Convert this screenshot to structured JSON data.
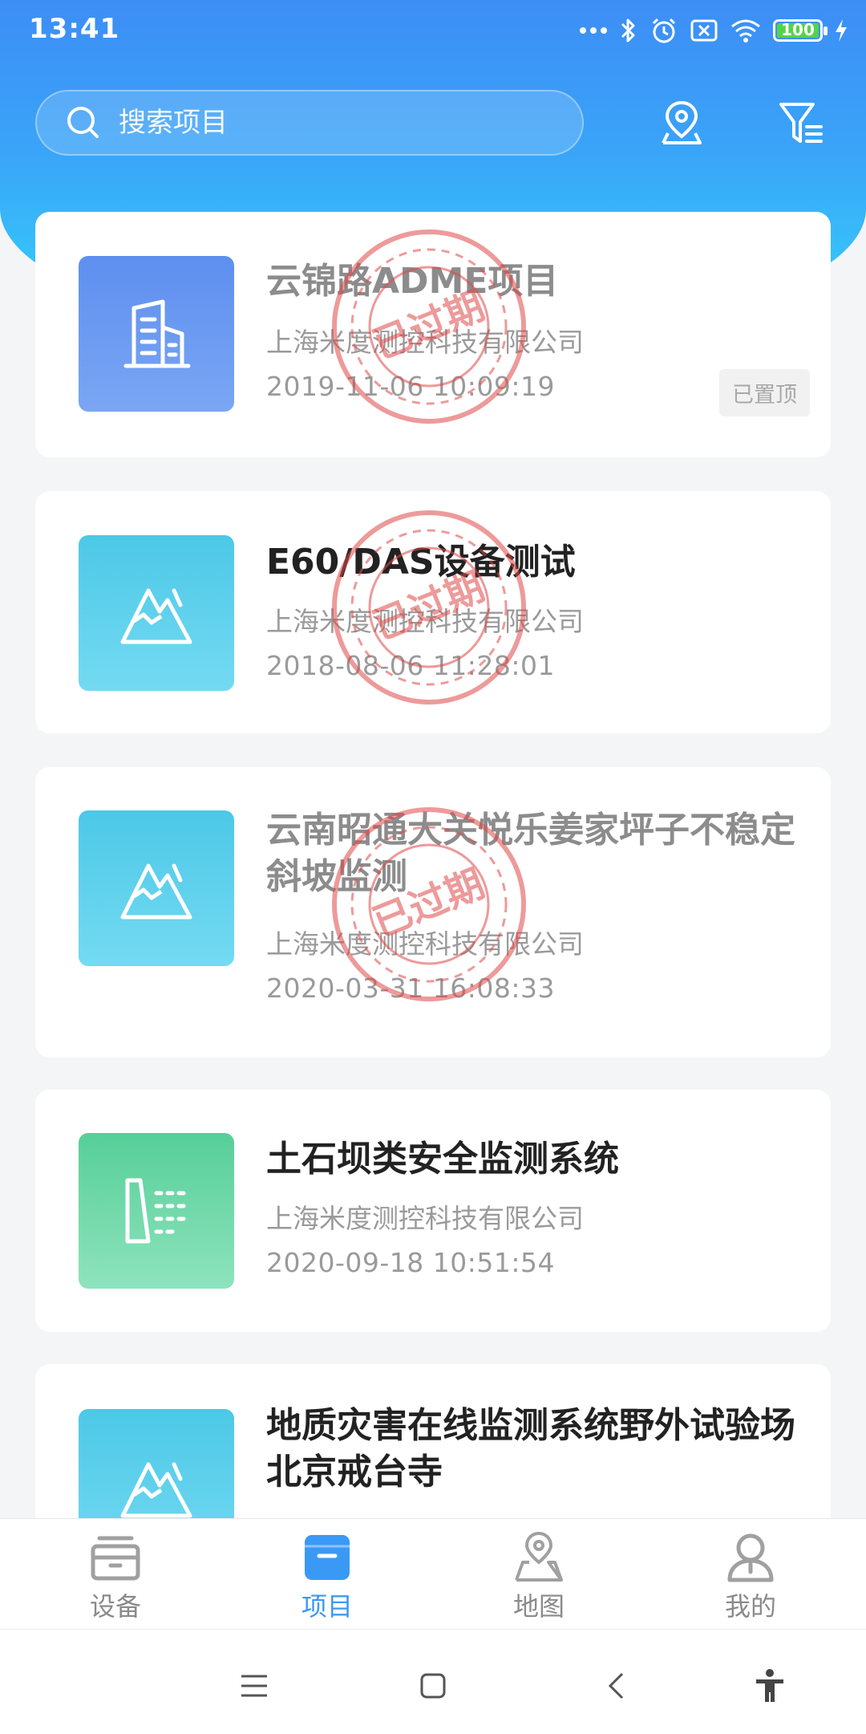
{
  "status": {
    "time": "13:41",
    "battery": "100"
  },
  "search": {
    "placeholder": "搜索项目"
  },
  "projects": [
    {
      "title": "云锦路ADME项目",
      "company": "上海米度测控科技有限公司",
      "date": "2019-11-06 10:09:19",
      "pinned_label": "已置顶",
      "stamp": "已过期",
      "icon": "building-icon"
    },
    {
      "title": "E60/DAS设备测试",
      "company": "上海米度测控科技有限公司",
      "date": "2018-08-06 11:28:01",
      "stamp": "已过期",
      "icon": "mountain-icon"
    },
    {
      "title": "云南昭通大关悦乐姜家坪子不稳定斜坡监测",
      "company": "上海米度测控科技有限公司",
      "date": "2020-03-31 16:08:33",
      "stamp": "已过期",
      "icon": "mountain-icon"
    },
    {
      "title": "土石坝类安全监测系统",
      "company": "上海米度测控科技有限公司",
      "date": "2020-09-18 10:51:54",
      "icon": "dam-icon"
    },
    {
      "title": "地质灾害在线监测系统野外试验场北京戒台寺",
      "icon": "mountain-icon"
    }
  ],
  "tabs": [
    {
      "label": "设备",
      "icon": "device-icon"
    },
    {
      "label": "项目",
      "icon": "project-icon",
      "active": true
    },
    {
      "label": "地图",
      "icon": "map-icon"
    },
    {
      "label": "我的",
      "icon": "profile-icon"
    }
  ],
  "colors": {
    "accent": "#3b99f6",
    "header_top": "#3d8df5",
    "header_bottom": "#33d7fb",
    "stamp": "#e04848"
  }
}
